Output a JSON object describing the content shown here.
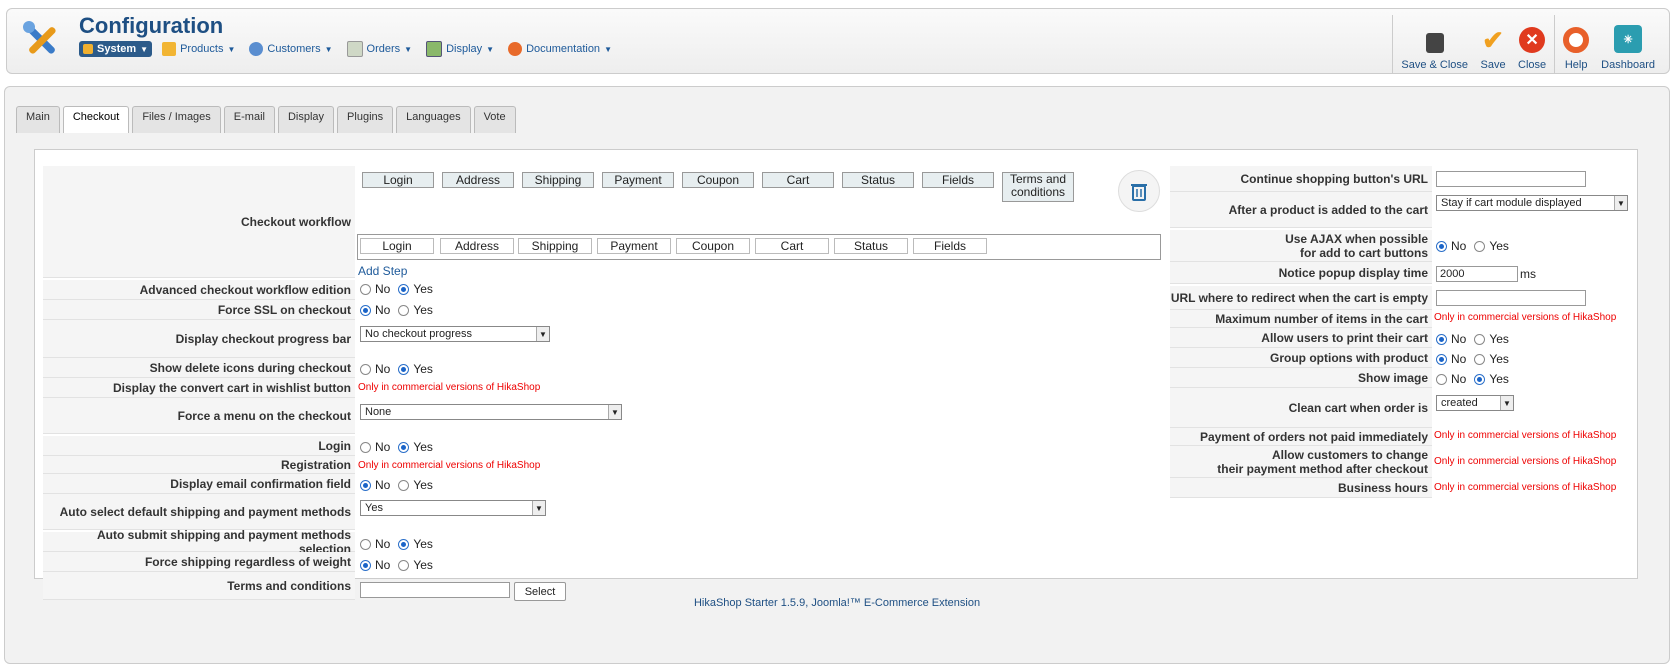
{
  "header": {
    "title": "Configuration",
    "menu": [
      {
        "label": "System",
        "icon": "wrench-icon"
      },
      {
        "label": "Products",
        "icon": "products-icon"
      },
      {
        "label": "Customers",
        "icon": "customers-icon"
      },
      {
        "label": "Orders",
        "icon": "orders-icon"
      },
      {
        "label": "Display",
        "icon": "display-icon"
      },
      {
        "label": "Documentation",
        "icon": "lifebuoy-icon"
      }
    ],
    "toolbar": {
      "save_close": "Save & Close",
      "save": "Save",
      "close": "Close",
      "help": "Help",
      "dashboard": "Dashboard"
    }
  },
  "tabs": [
    "Main",
    "Checkout",
    "Files / Images",
    "E-mail",
    "Display",
    "Plugins",
    "Languages",
    "Vote"
  ],
  "left": {
    "checkout_workflow": "Checkout workflow",
    "steps_top": [
      "Login",
      "Address",
      "Shipping",
      "Payment",
      "Coupon",
      "Cart",
      "Status",
      "Fields",
      "Terms and conditions"
    ],
    "steps_bottom": [
      "Login",
      "Address",
      "Shipping",
      "Payment",
      "Coupon",
      "Cart",
      "Status",
      "Fields"
    ],
    "add_step": "Add Step",
    "advanced_workflow": "Advanced checkout workflow edition",
    "force_ssl": "Force SSL on checkout",
    "progress_bar": "Display checkout progress bar",
    "progress_bar_value": "No checkout progress",
    "delete_icons": "Show delete icons during checkout",
    "convert_cart": "Display the convert cart in wishlist button",
    "force_menu": "Force a menu on the checkout",
    "force_menu_value": "None",
    "login": "Login",
    "registration": "Registration",
    "email_confirm": "Display email confirmation field",
    "auto_select": "Auto select default shipping and payment methods",
    "auto_select_value": "Yes",
    "auto_submit": "Auto submit shipping and payment methods selection",
    "force_shipping": "Force shipping regardless of weight",
    "terms": "Terms and conditions",
    "select_button": "Select"
  },
  "right": {
    "continue_url": "Continue shopping button's URL",
    "after_added": "After a product is added to the cart",
    "after_added_value": "Stay if cart module displayed",
    "use_ajax_1": "Use AJAX when possible",
    "use_ajax_2": "for add to cart buttons",
    "notice_popup": "Notice popup display time",
    "notice_popup_value": "2000",
    "notice_unit": "ms",
    "redirect_empty": "URL where to redirect when the cart is empty",
    "max_items": "Maximum number of items in the cart",
    "print_cart": "Allow users to print their cart",
    "group_options": "Group options with product",
    "show_image": "Show image",
    "clean_cart": "Clean cart when order is",
    "clean_cart_value": "created",
    "payment_not_paid": "Payment of orders not paid immediately",
    "change_payment_1": "Allow customers to change",
    "change_payment_2": "their payment method after checkout",
    "business_hours": "Business hours"
  },
  "common": {
    "no": "No",
    "yes": "Yes",
    "commercial": "Only in commercial versions of HikaShop"
  },
  "footer": "HikaShop Starter 1.5.9, Joomla!™ E-Commerce Extension"
}
